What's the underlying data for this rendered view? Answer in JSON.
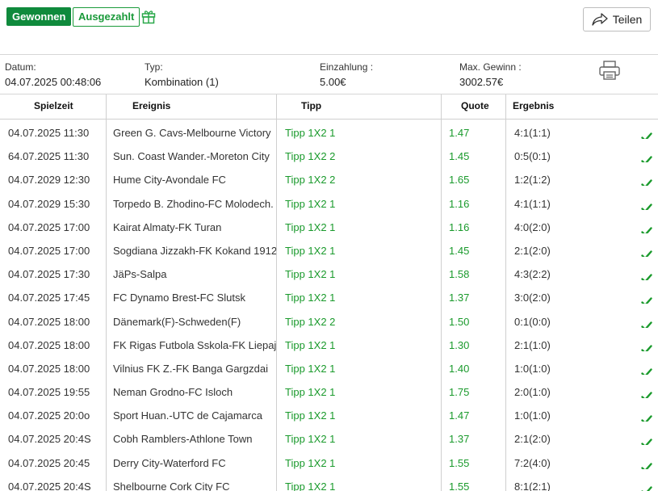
{
  "header": {
    "won_badge": "Gewonnen",
    "paid_badge": "Ausgezahlt",
    "gift_icon": "gift-icon",
    "share_label": "Teilen",
    "share_icon": "share-arrow-icon"
  },
  "info": {
    "date_label": "Datum:",
    "date_value": "04.07.2025 00:48:06",
    "type_label": "Typ:",
    "type_value": "Kombination (1)",
    "stake_label": "Einzahlung :",
    "stake_value": "5.00€",
    "maxwin_label": "Max. Gewinn :",
    "maxwin_value": "3002.57€",
    "print_icon": "printer-icon"
  },
  "table": {
    "headers": [
      "Spielzeit",
      "Ereignis",
      "Tipp",
      "Quote",
      "Ergebnis"
    ],
    "rows": [
      {
        "time": "04.07.2025 11:30",
        "event": "Green G. Cavs-Melbourne Victory",
        "tip": "Tipp 1X2 1",
        "odds": "1.47",
        "result": "4:1(1:1)"
      },
      {
        "time": "64.07.2025 11:30",
        "event": "Sun. Coast Wander.-Moreton City",
        "tip": "Tipp 1X2 2",
        "odds": "1.45",
        "result": "0:5(0:1)"
      },
      {
        "time": "04.07.2029 12:30",
        "event": "Hume City-Avondale FC",
        "tip": "Tipp 1X2 2",
        "odds": "1.65",
        "result": "1:2(1:2)"
      },
      {
        "time": "04.07.2029 15:30",
        "event": "Torpedo B. Zhodino-FC Molodech.",
        "tip": "Tipp 1X2 1",
        "odds": "1.16",
        "result": "4:1(1:1)"
      },
      {
        "time": "04.07.2025 17:00",
        "event": "Kairat Almaty-FK Turan",
        "tip": "Tipp 1X2 1",
        "odds": "1.16",
        "result": "4:0(2:0)"
      },
      {
        "time": "04.07.2025 17:00",
        "event": "Sogdiana Jizzakh-FK Kokand 1912",
        "tip": "Tipp 1X2 1",
        "odds": "1.45",
        "result": "2:1(2:0)"
      },
      {
        "time": "04.07.2025 17:30",
        "event": "JäPs-Salpa",
        "tip": "Tipp 1X2 1",
        "odds": "1.58",
        "result": "4:3(2:2)"
      },
      {
        "time": "04.07.2025 17:45",
        "event": "FC Dynamo Brest-FC Slutsk",
        "tip": "Tipp 1X2 1",
        "odds": "1.37",
        "result": "3:0(2:0)"
      },
      {
        "time": "04.07.2025 18:00",
        "event": "Dänemark(F)-Schweden(F)",
        "tip": "Tipp 1X2 2",
        "odds": "1.50",
        "result": "0:1(0:0)"
      },
      {
        "time": "04.07.2025 18:00",
        "event": "FK Rigas Futbola Sskola-FK Liepaja",
        "tip": "Tipp 1X2 1",
        "odds": "1.30",
        "result": "2:1(1:0)"
      },
      {
        "time": "04.07.2025 18:00",
        "event": "Vilnius FK Z.-FK Banga Gargzdai",
        "tip": "Tipp 1X2 1",
        "odds": "1.40",
        "result": "1:0(1:0)"
      },
      {
        "time": "04.07.2025 19:55",
        "event": "Neman Grodno-FC Isloch",
        "tip": "Tipp 1X2 1",
        "odds": "1.75",
        "result": "2:0(1:0)"
      },
      {
        "time": "04.07.2025 20:0o",
        "event": "Sport Huan.-UTC de Cajamarca",
        "tip": "Tipp 1X2 1",
        "odds": "1.47",
        "result": "1:0(1:0)"
      },
      {
        "time": "04.07.2025 20:4S",
        "event": "Cobh Ramblers-Athlone Town",
        "tip": "Tipp 1X2 1",
        "odds": "1.37",
        "result": "2:1(2:0)"
      },
      {
        "time": "04.07.2025 20:45",
        "event": "Derry City-Waterford FC",
        "tip": "Tipp 1X2 1",
        "odds": "1.55",
        "result": "7:2(4:0)"
      },
      {
        "time": "04.07.2025 20:4S",
        "event": "Shelbourne Cork City FC",
        "tip": "Tipp 1X2 1",
        "odds": "1.55",
        "result": "8:1(2:1)"
      }
    ],
    "status_icon": "checkmark-icon"
  },
  "colors": {
    "won_bg": "#0f8a3c",
    "accent_green": "#1a9a2c",
    "border": "#cfcfcf"
  }
}
